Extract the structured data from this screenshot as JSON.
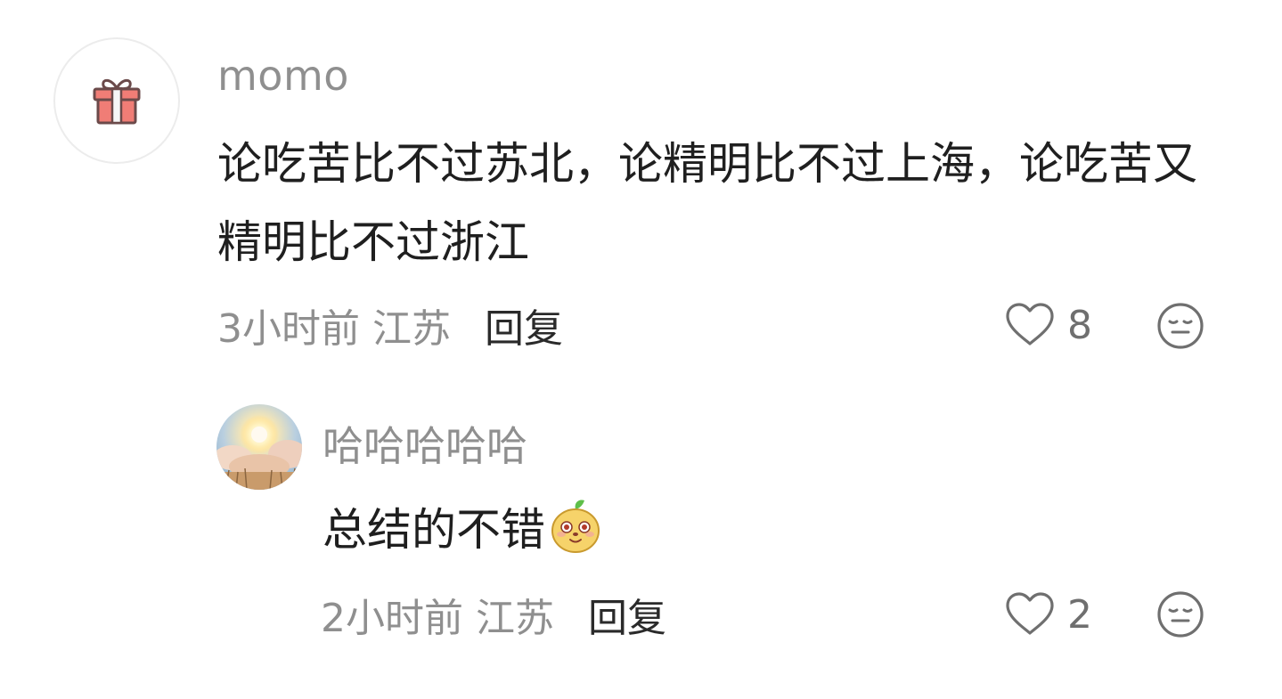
{
  "comments": [
    {
      "username": "momo",
      "text": "论吃苦比不过苏北，论精明比不过上海，论吃苦又精明比不过浙江",
      "time": "3小时前",
      "location": "江苏",
      "reply_label": "回复",
      "likes": "8",
      "avatar_icon": "gift-icon",
      "more_icon": "meh-face-icon"
    }
  ],
  "replies": [
    {
      "username": "哈哈哈哈哈",
      "text": "总结的不错",
      "emoji": "cute-face-emoji",
      "time": "2小时前",
      "location": "江苏",
      "reply_label": "回复",
      "likes": "2",
      "avatar_icon": "sun-clouds-avatar",
      "more_icon": "meh-face-icon"
    }
  ],
  "colors": {
    "meta": "#8f8f8f",
    "text": "#1f1f1f",
    "gift": "#f07d76"
  }
}
